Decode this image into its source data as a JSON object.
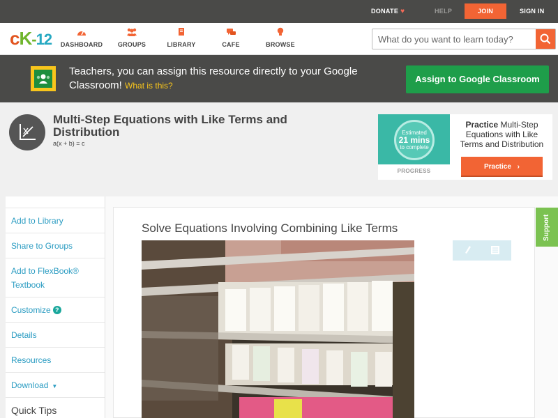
{
  "topbar": {
    "donate": "DONATE",
    "help": "HELP",
    "join": "JOIN",
    "signin": "SIGN IN"
  },
  "header": {
    "nav": [
      {
        "label": "DASHBOARD",
        "icon": "speedometer-icon"
      },
      {
        "label": "GROUPS",
        "icon": "people-icon"
      },
      {
        "label": "LIBRARY",
        "icon": "book-icon"
      },
      {
        "label": "CAFE",
        "icon": "chat-bubbles-icon"
      },
      {
        "label": "BROWSE",
        "icon": "lightbulb-icon"
      }
    ],
    "search_placeholder": "What do you want to learn today?"
  },
  "banner": {
    "text": "Teachers, you can assign this resource directly to your Google Classroom!",
    "what_link": "What is this?",
    "assign_button": "Assign to Google Classroom"
  },
  "page": {
    "title": "Multi-Step Equations with Like Terms and Distribution",
    "subtitle": "a(x + b) = c"
  },
  "practice": {
    "circle_line1": "Estimated",
    "circle_line2": "21 mins",
    "circle_line3": "to complete",
    "progress_label": "PROGRESS",
    "text_bold": "Practice",
    "text_rest": "Multi-Step Equations with Like Terms and Distribution",
    "button": "Practice"
  },
  "sidebar": {
    "items": [
      {
        "label": "Add to Library"
      },
      {
        "label": "Share to Groups"
      },
      {
        "label": "Add to FlexBook® Textbook"
      },
      {
        "label": "Customize"
      },
      {
        "label": "Details"
      },
      {
        "label": "Resources"
      },
      {
        "label": "Download"
      },
      {
        "label": "Quick Tips"
      }
    ]
  },
  "content": {
    "title": "Solve Equations Involving Combining Like Terms"
  },
  "support_tab": "Support",
  "colors": {
    "orange": "#f26434",
    "dark_bar": "#4a4a48",
    "link_blue": "#2b9cc2",
    "green_button": "#1e9e4a",
    "teal": "#3ab8a6"
  }
}
